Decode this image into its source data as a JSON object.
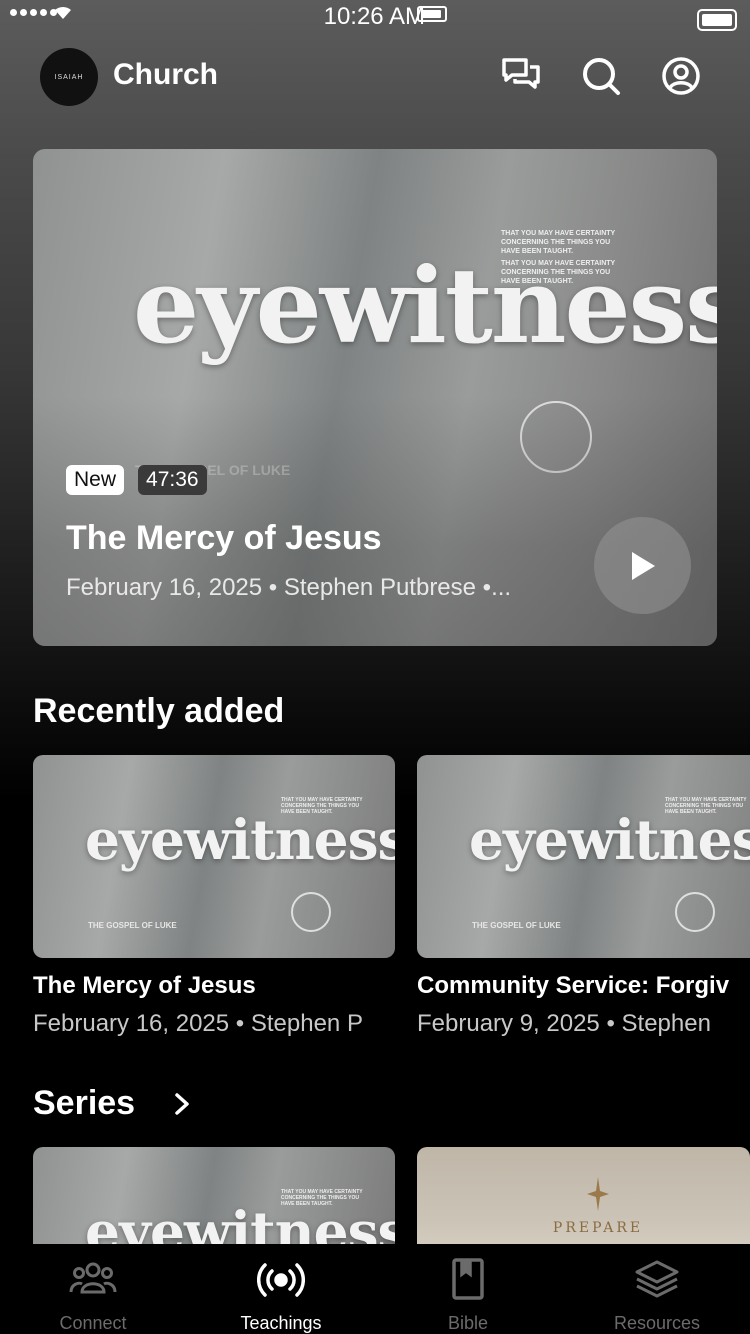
{
  "status": {
    "time": "10:26 AM"
  },
  "header": {
    "logo_text": "ISAIAH",
    "title": "Church"
  },
  "hero": {
    "art_word": "eyewitness",
    "art_subtitle": "THE GOSPEL OF LUKE",
    "art_fine_print": "THAT YOU MAY HAVE CERTAINTY CONCERNING THE THINGS YOU HAVE BEEN TAUGHT.",
    "badge_new": "New",
    "duration": "47:36",
    "title": "The Mercy of Jesus",
    "meta": "February 16, 2025 • Stephen Putbrese •..."
  },
  "recently_added": {
    "heading": "Recently added",
    "items": [
      {
        "title": "The Mercy of Jesus",
        "meta": "February 16, 2025 • Stephen P",
        "art_word": "eyewitness",
        "art_subtitle": "THE GOSPEL OF LUKE"
      },
      {
        "title": "Community Service: Forgiv",
        "meta": "February 9, 2025 • Stephen",
        "art_word": "eyewitness",
        "art_subtitle": "THE GOSPEL OF LUKE"
      }
    ]
  },
  "series": {
    "heading": "Series",
    "items": [
      {
        "art_word": "eyewitness"
      },
      {
        "art_word": "PREPARE"
      }
    ]
  },
  "tabbar": {
    "tabs": [
      {
        "label": "Connect",
        "icon": "people-icon",
        "active": false
      },
      {
        "label": "Teachings",
        "icon": "broadcast-icon",
        "active": true
      },
      {
        "label": "Bible",
        "icon": "book-icon",
        "active": false
      },
      {
        "label": "Resources",
        "icon": "layers-icon",
        "active": false
      }
    ]
  }
}
